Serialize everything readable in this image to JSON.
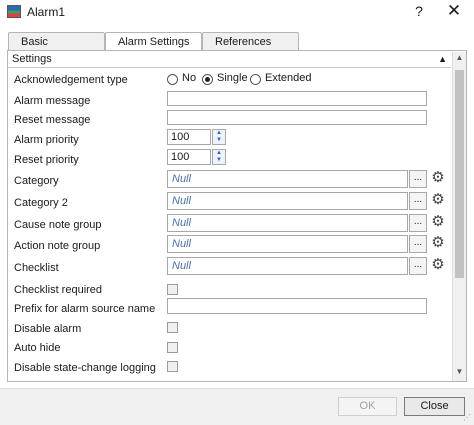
{
  "window": {
    "title": "Alarm1",
    "help_label": "?",
    "close_label": "✕"
  },
  "tabs": [
    {
      "label": "Basic"
    },
    {
      "label": "Alarm Settings"
    },
    {
      "label": "References"
    }
  ],
  "section": {
    "title": "Settings",
    "collapse_glyph": "▲"
  },
  "rows": {
    "ack_type": "Acknowledgement type",
    "alarm_message": "Alarm message",
    "reset_message": "Reset message",
    "alarm_priority": "Alarm priority",
    "reset_priority": "Reset priority",
    "category": "Category",
    "category2": "Category 2",
    "cause_note_group": "Cause note group",
    "action_note_group": "Action note group",
    "checklist": "Checklist",
    "checklist_required": "Checklist required",
    "prefix_alarm_source": "Prefix for alarm source name",
    "disable_alarm": "Disable alarm",
    "auto_hide": "Auto hide",
    "disable_state_logging": "Disable state-change logging"
  },
  "ack_options": [
    {
      "label": "No",
      "selected": false
    },
    {
      "label": "Single",
      "selected": true
    },
    {
      "label": "Extended",
      "selected": false
    }
  ],
  "values": {
    "alarm_message": "",
    "reset_message": "",
    "alarm_priority": "100",
    "reset_priority": "100",
    "category": "Null",
    "category2": "Null",
    "cause_note_group": "Null",
    "action_note_group": "Null",
    "checklist": "Null",
    "prefix_alarm_source": ""
  },
  "browse_label": "...",
  "gear_glyph": "⚙",
  "spin": {
    "up": "▲",
    "down": "▼"
  },
  "scrollbar": {
    "up": "▲",
    "down": "▼"
  },
  "footer": {
    "ok_label": "OK",
    "close_label": "Close",
    "ok_enabled": false
  },
  "resize_glyph": "⋰"
}
